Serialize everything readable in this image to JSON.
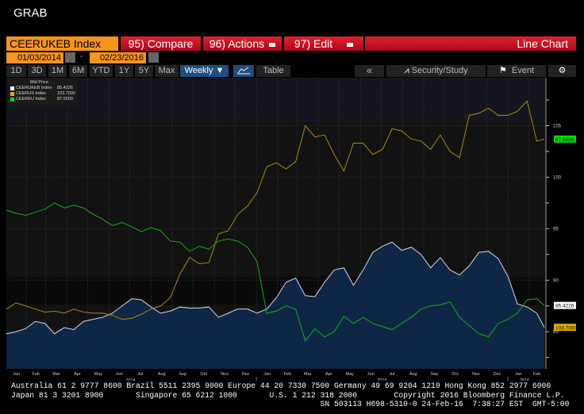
{
  "window_title": "GRAB",
  "toolbar": {
    "security": "CEERUKEB Index",
    "compare": "95) Compare",
    "actions": "96) Actions",
    "edit": "97) Edit",
    "view": "Line Chart"
  },
  "dates": {
    "start": "01/03/2014",
    "separator": "-",
    "end": "02/23/2016"
  },
  "periods": [
    "1D",
    "3D",
    "1M",
    "6M",
    "YTD",
    "1Y",
    "5Y",
    "Max"
  ],
  "frequency": "Weekly",
  "table_label": "Table",
  "right_buttons": {
    "collapse": "«",
    "security_study": "Security/Study",
    "event": "Event"
  },
  "icons": [
    "calendar-icon",
    "line-chart-icon",
    "bar-chart-icon",
    "flag-icon",
    "gear-icon",
    "dropdown-icon"
  ],
  "legend": {
    "title": "Mid Price",
    "items": [
      {
        "name": "CEERUKEB Index",
        "value": "85.4226",
        "color": "#ffffff"
      },
      {
        "name": "CEERUS Index",
        "value": "103.7000",
        "color": "#e0b000"
      },
      {
        "name": "CEEREU  Index",
        "value": "87.5500",
        "color": "#00e000"
      }
    ]
  },
  "chart_data": {
    "type": "line",
    "ylim": [
      81.4,
      108.5
    ],
    "yticks": [
      85,
      90,
      95,
      100,
      105
    ],
    "grid": true,
    "legend_position": "top-left",
    "x": [
      "2014-01-03",
      "2014-01-17",
      "2014-01-31",
      "2014-02-14",
      "2014-02-28",
      "2014-03-14",
      "2014-03-28",
      "2014-04-11",
      "2014-04-25",
      "2014-05-09",
      "2014-05-23",
      "2014-06-06",
      "2014-06-20",
      "2014-07-04",
      "2014-07-18",
      "2014-08-01",
      "2014-08-15",
      "2014-08-29",
      "2014-09-12",
      "2014-09-26",
      "2014-10-10",
      "2014-10-24",
      "2014-11-07",
      "2014-11-21",
      "2014-12-05",
      "2014-12-19",
      "2015-01-02",
      "2015-01-16",
      "2015-01-30",
      "2015-02-13",
      "2015-02-27",
      "2015-03-13",
      "2015-03-27",
      "2015-04-10",
      "2015-04-24",
      "2015-05-08",
      "2015-05-22",
      "2015-06-05",
      "2015-06-19",
      "2015-07-03",
      "2015-07-17",
      "2015-07-31",
      "2015-08-14",
      "2015-08-28",
      "2015-09-11",
      "2015-09-25",
      "2015-10-09",
      "2015-10-23",
      "2015-11-06",
      "2015-11-20",
      "2015-12-04",
      "2015-12-18",
      "2016-01-01",
      "2016-01-15",
      "2016-01-29",
      "2016-02-12",
      "2016-02-23"
    ],
    "series": [
      {
        "name": "CEERUKEB Index",
        "color": "#d8d8e0",
        "fill": true,
        "values": [
          84.8,
          85.0,
          85.3,
          86.0,
          85.8,
          84.8,
          85.4,
          85.2,
          86.0,
          86.2,
          86.4,
          86.8,
          87.5,
          88.2,
          88.1,
          87.4,
          86.8,
          87.0,
          87.4,
          87.3,
          87.3,
          87.4,
          86.4,
          86.8,
          87.2,
          87.2,
          86.8,
          87.2,
          88.3,
          89.8,
          90.2,
          88.5,
          88.4,
          89.8,
          91.0,
          91.2,
          89.5,
          91.0,
          92.7,
          93.3,
          93.7,
          92.9,
          93.2,
          92.5,
          91.2,
          92.2,
          91.0,
          90.5,
          91.4,
          92.7,
          92.8,
          92.1,
          90.4,
          87.7,
          87.4,
          86.8,
          85.4226
        ]
      },
      {
        "name": "CEERUS Index",
        "color": "#a88a10",
        "values": [
          87.2,
          87.8,
          87.5,
          87.2,
          86.9,
          87.0,
          86.8,
          87.2,
          86.9,
          86.8,
          86.8,
          86.6,
          86.2,
          86.3,
          86.7,
          87.2,
          87.5,
          88.3,
          90.6,
          92.2,
          91.6,
          91.7,
          94.5,
          94.8,
          96.4,
          97.2,
          98.5,
          101.0,
          101.4,
          100.8,
          101.5,
          105.0,
          103.9,
          104.1,
          102.2,
          100.6,
          103.3,
          103.3,
          102.2,
          102.7,
          104.7,
          104.5,
          103.7,
          103.5,
          102.7,
          104.1,
          102.5,
          101.9,
          106.0,
          106.2,
          106.7,
          106.0,
          106.0,
          106.4,
          107.4,
          103.5,
          103.7
        ]
      },
      {
        "name": "CEEREU  Index",
        "color": "#10b010",
        "values": [
          96.8,
          96.5,
          96.3,
          96.6,
          96.9,
          97.5,
          97.0,
          97.3,
          97.0,
          96.4,
          95.9,
          95.3,
          95.6,
          95.2,
          94.7,
          95.1,
          94.8,
          93.8,
          93.7,
          92.8,
          93.3,
          93.0,
          93.8,
          94.0,
          93.8,
          93.2,
          91.8,
          86.8,
          87.0,
          87.5,
          87.2,
          84.1,
          85.3,
          84.5,
          85.0,
          86.5,
          85.8,
          86.4,
          85.8,
          85.5,
          85.2,
          85.8,
          86.4,
          87.2,
          87.5,
          87.6,
          87.9,
          86.4,
          85.6,
          84.8,
          84.5,
          85.8,
          86.2,
          86.8,
          88.1,
          88.2,
          87.55
        ]
      }
    ],
    "value_tags": [
      {
        "text": "103.7000",
        "color": "#e0b000"
      },
      {
        "text": "87.5500",
        "color": "#00e000"
      },
      {
        "text": "85.4226",
        "color": "#ffffff"
      }
    ],
    "month_labels": [
      "Jan",
      "Feb",
      "Mar",
      "Apr",
      "May",
      "Jun",
      "Jul",
      "Aug",
      "Sep",
      "Oct",
      "Nov",
      "Dec",
      "Jan",
      "Feb",
      "Mar",
      "Apr",
      "May",
      "Jun",
      "Jul",
      "Aug",
      "Sep",
      "Oct",
      "Nov",
      "Dec",
      "Jan",
      "Feb"
    ],
    "year_labels": [
      "2014",
      "2015",
      "2016"
    ]
  },
  "footer": {
    "line1": "Australia 61 2 9777 8600 Brazil 5511 2395 9000 Europe 44 20 7330 7500 Germany 49 69 9204 1210 Hong Kong 852 2977 6000",
    "line2": "Japan 81 3 3201 8900       Singapore 65 6212 1000       U.S. 1 212 318 2000        Copyright 2016 Bloomberg Finance L.P.",
    "line3": "                                                                   SN 503113 H698-5310-0 24-Feb-16  7:38:27 EST  GMT-5:00"
  }
}
